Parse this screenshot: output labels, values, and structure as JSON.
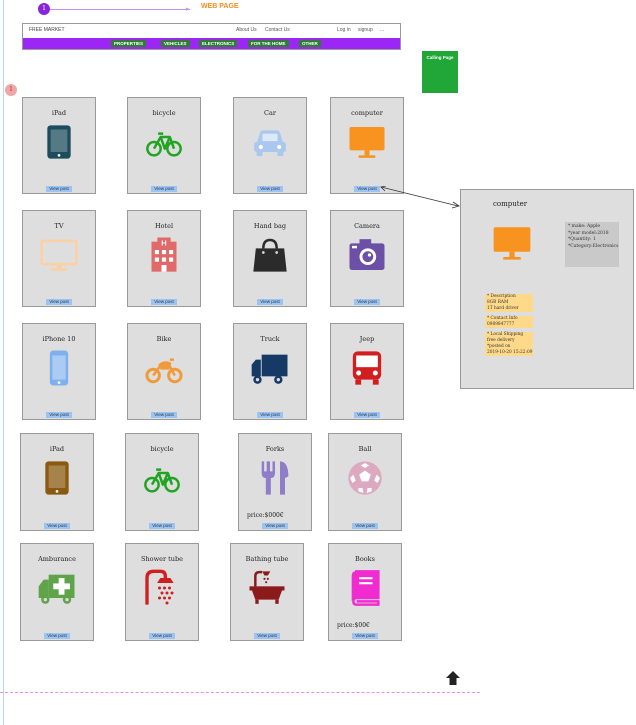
{
  "flow": {
    "step1": "1",
    "step2": "1",
    "title": "WEB PAGE"
  },
  "header": {
    "brand": "FREE MARKET",
    "nav": [
      "About Us",
      "Contact Us",
      "Log in",
      "signup",
      "..."
    ],
    "categories": [
      "PROPERTIES",
      "VEHICLES",
      "ELECTRONICS",
      "FOR THE HOME",
      "OTHER"
    ]
  },
  "calling_page": "Calling Page",
  "cards": [
    {
      "title": "iPad",
      "icon": "tablet-icon",
      "color": "#1d4d5c",
      "button": "View post"
    },
    {
      "title": "bicycle",
      "icon": "bicycle-icon",
      "color": "#22a322",
      "button": "View post"
    },
    {
      "title": "Car",
      "icon": "car-icon",
      "color": "#a9c7ef",
      "button": "View post"
    },
    {
      "title": "computer",
      "icon": "monitor-icon",
      "color": "#f7931e",
      "button": "View post"
    },
    {
      "title": "TV",
      "icon": "tv-icon",
      "color": "#fbd0a2",
      "button": "View post"
    },
    {
      "title": "Hotel",
      "icon": "hotel-icon",
      "color": "#e06a6a",
      "button": "View post"
    },
    {
      "title": "Hand bag",
      "icon": "handbag-icon",
      "color": "#2b2b2b",
      "button": "View post"
    },
    {
      "title": "Camera",
      "icon": "camera-icon",
      "color": "#6c4fa6",
      "button": "View post"
    },
    {
      "title": "iPhone 10",
      "icon": "phone-icon",
      "color": "#7fb0ee",
      "button": "View post"
    },
    {
      "title": "Bike",
      "icon": "motorbike-icon",
      "color": "#f09a3c",
      "button": "View post"
    },
    {
      "title": "Truck",
      "icon": "truck-icon",
      "color": "#163a66",
      "button": "View post"
    },
    {
      "title": "Jeep",
      "icon": "bus-icon",
      "color": "#d11f1f",
      "button": "View post"
    },
    {
      "title": "iPad",
      "icon": "tablet-icon",
      "color": "#8a5a10",
      "button": "View post"
    },
    {
      "title": "bicycle",
      "icon": "bicycle-icon",
      "color": "#22a322",
      "button": "View post"
    },
    {
      "title": "Forks",
      "icon": "fork-knife-icon",
      "color": "#8f7dc9",
      "button": "View post",
      "price": "price:$000€"
    },
    {
      "title": "Ball",
      "icon": "soccer-ball-icon",
      "color": "#dca9c0",
      "button": "View post"
    },
    {
      "title": "Amburance",
      "icon": "ambulance-icon",
      "color": "#5fa34a",
      "button": "View post"
    },
    {
      "title": "Shower tube",
      "icon": "shower-icon",
      "color": "#d11f1f",
      "button": "View post"
    },
    {
      "title": "Bathing tube",
      "icon": "bathtub-icon",
      "color": "#8b1a1a",
      "button": "View post"
    },
    {
      "title": "Books",
      "icon": "book-icon",
      "color": "#f02cd0",
      "button": "View post",
      "price": "price:$00€"
    }
  ],
  "detail": {
    "title": "computer",
    "icon": "monitor-icon",
    "specs": [
      "* make: Apple",
      "*year model:2018",
      "*Quantity: 1",
      "*Category:Electronics"
    ],
    "notes": [
      [
        "* Description",
        "8GB RAM",
        "1T hard driver"
      ],
      [
        "* Contact Info",
        "0989847777"
      ],
      [
        "* Local Shipping",
        "free delivery"
      ],
      [
        "*posted on",
        "2019-10-20 15:22:09"
      ]
    ]
  }
}
